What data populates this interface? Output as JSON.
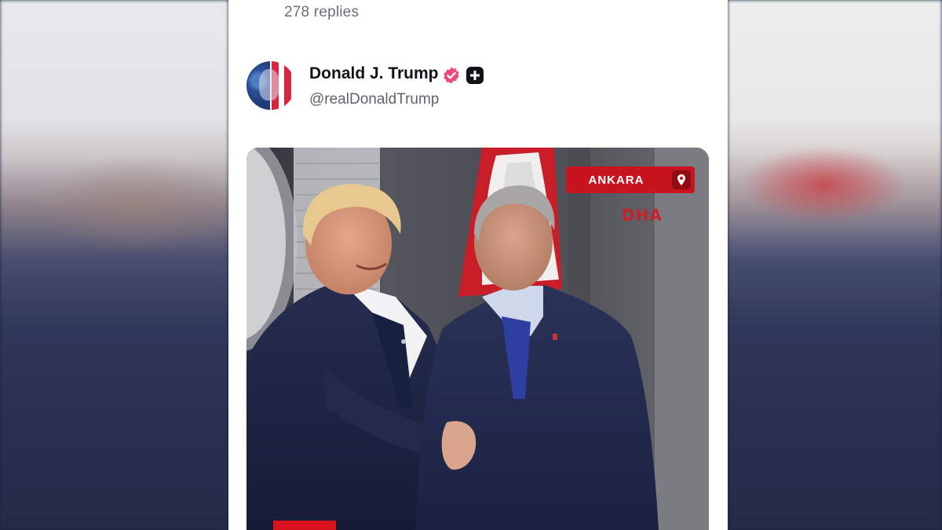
{
  "thread": {
    "replies_label": "278 replies"
  },
  "post": {
    "author_name": "Donald J. Trump",
    "author_handle": "@realDonaldTrump",
    "verified": true,
    "badges": [
      "verified-icon",
      "plus-badge-icon"
    ],
    "media": {
      "type": "video",
      "location_overlay": "ANKARA",
      "watermark": "DHA"
    }
  },
  "colors": {
    "verified_badge": "#ea4c7a",
    "overlay_red": "#c8141e",
    "text_primary": "#111318",
    "text_secondary": "#5f636b"
  }
}
